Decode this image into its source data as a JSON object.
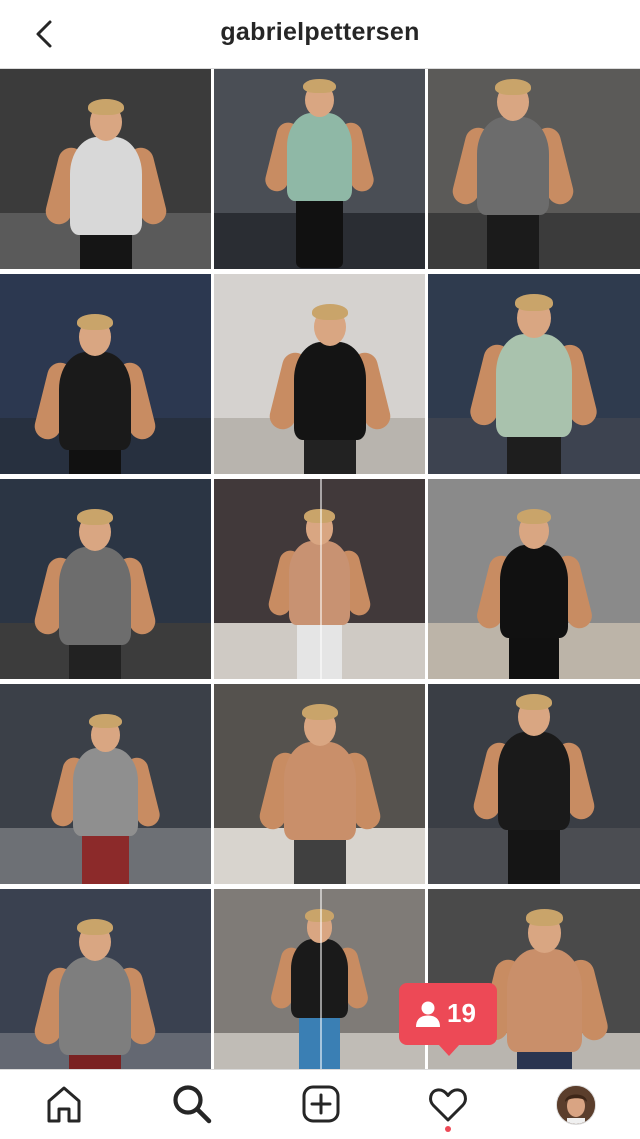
{
  "header": {
    "back_icon": "chevron-left-icon",
    "username": "gabrielpettersen"
  },
  "grid": {
    "posts": [
      {
        "shirt": "#d8d8d8",
        "bg": "#3b3b3b",
        "floor": "#5a5a5a",
        "legs": "#151515"
      },
      {
        "shirt": "#8fb8a6",
        "bg": "#4a4e55",
        "floor": "#2a2d33",
        "legs": "#111111"
      },
      {
        "shirt": "#6c6c6c",
        "bg": "#5b5a58",
        "floor": "#3b3b3b",
        "legs": "#1b1b1b"
      },
      {
        "shirt": "#1a1a1a",
        "bg": "#2c3850",
        "floor": "#27303f",
        "legs": "#111111"
      },
      {
        "shirt": "#141414",
        "bg": "#d5d2cf",
        "floor": "#b8b4ae",
        "legs": "#222222"
      },
      {
        "shirt": "#a9c2ad",
        "bg": "#2f3b4e",
        "floor": "#3d4350",
        "legs": "#1e1e1e"
      },
      {
        "shirt": "#6d6d6d",
        "bg": "#2b3544",
        "floor": "#3c3c3c",
        "legs": "#222222"
      },
      {
        "shirt": "#c89272",
        "bg": "#41393a",
        "floor": "#cfcac4",
        "legs": "#e5e5e5"
      },
      {
        "shirt": "#111111",
        "bg": "#8a8a8a",
        "floor": "#bcb4a8",
        "legs": "#101010"
      },
      {
        "shirt": "#8f8f8f",
        "bg": "#3b4048",
        "floor": "#6d7075",
        "legs": "#8c2a2a"
      },
      {
        "shirt": "#c98f6a",
        "bg": "#55524e",
        "floor": "#d8d4ce",
        "legs": "#404040"
      },
      {
        "shirt": "#1a1a1a",
        "bg": "#3a3e45",
        "floor": "#4b4d52",
        "legs": "#151515"
      },
      {
        "shirt": "#7e7e7e",
        "bg": "#3a4150",
        "floor": "#646872",
        "legs": "#7a2222"
      },
      {
        "shirt": "#1a1a1a",
        "bg": "#7f7b77",
        "floor": "#c0bcb6",
        "legs": "#3a7fb4"
      },
      {
        "shirt": "#c98f6a",
        "bg": "#4a4a4a",
        "floor": "#b9b5af",
        "legs": "#2a3550"
      }
    ]
  },
  "notification": {
    "icon": "person-icon",
    "count": "19",
    "color": "#ed4956"
  },
  "bottom_nav": {
    "items": [
      "home-icon",
      "search-icon",
      "add-post-icon",
      "activity-heart-icon",
      "profile-avatar"
    ],
    "activity_dot_color": "#ed4956"
  }
}
